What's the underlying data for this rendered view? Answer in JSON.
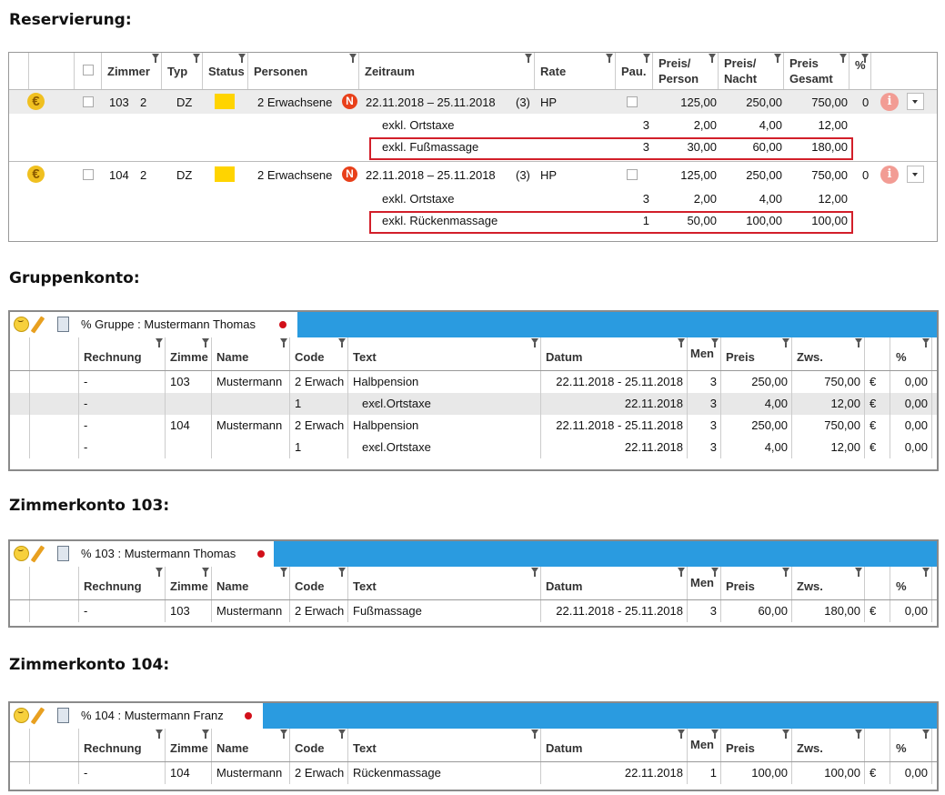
{
  "headings": {
    "reservierung": "Reservierung:",
    "gruppenkonto": "Gruppenkonto:",
    "zimmerkonto103": "Zimmerkonto 103:",
    "zimmerkonto104": "Zimmerkonto 104:"
  },
  "reservation": {
    "columns": {
      "zimmer": "Zimmer",
      "typ": "Typ",
      "status": "Status",
      "personen": "Personen",
      "zeitraum": "Zeitraum",
      "rate": "Rate",
      "pau": "Pau.",
      "preis_person_1": "Preis/",
      "preis_person_2": "Person",
      "preis_nacht_1": "Preis/",
      "preis_nacht_2": "Nacht",
      "preis_gesamt_1": "Preis",
      "preis_gesamt_2": "Gesamt",
      "pct": "%"
    },
    "bookings": [
      {
        "room": "103",
        "count": "2",
        "typ": "DZ",
        "personen": "2 Erwachsene",
        "badge": "N",
        "zeitraum": "22.11.2018 – 25.11.2018",
        "nights": "(3)",
        "rate": "HP",
        "preis_person": "125,00",
        "preis_nacht": "250,00",
        "preis_gesamt": "750,00",
        "pct": "0",
        "extras": [
          {
            "text": "exkl. Ortstaxe",
            "qty": "3",
            "pp": "2,00",
            "pn": "4,00",
            "pg": "12,00",
            "highlight": false
          },
          {
            "text": "exkl. Fußmassage",
            "qty": "3",
            "pp": "30,00",
            "pn": "60,00",
            "pg": "180,00",
            "highlight": true
          }
        ]
      },
      {
        "room": "104",
        "count": "2",
        "typ": "DZ",
        "personen": "2 Erwachsene",
        "badge": "N",
        "zeitraum": "22.11.2018 – 25.11.2018",
        "nights": "(3)",
        "rate": "HP",
        "preis_person": "125,00",
        "preis_nacht": "250,00",
        "preis_gesamt": "750,00",
        "pct": "0",
        "extras": [
          {
            "text": "exkl. Ortstaxe",
            "qty": "3",
            "pp": "2,00",
            "pn": "4,00",
            "pg": "12,00",
            "highlight": false
          },
          {
            "text": "exkl. Rückenmassage",
            "qty": "1",
            "pp": "50,00",
            "pn": "100,00",
            "pg": "100,00",
            "highlight": true
          }
        ]
      }
    ],
    "icons": {
      "euro": "euro-coin-icon",
      "info": "info-icon",
      "dropdown": "chevron-down-icon"
    },
    "colors": {
      "status": "#ffd400",
      "highlight_border": "#d21f2a"
    }
  },
  "account_columns": {
    "rechnung": "Rechnung",
    "zimmer": "Zimme",
    "name": "Name",
    "code": "Code",
    "text": "Text",
    "datum": "Datum",
    "menge": "Men",
    "preis": "Preis",
    "zws": "Zws.",
    "pct": "%"
  },
  "group_account": {
    "tab_label": "% Gruppe :  Mustermann Thomas",
    "rows": [
      {
        "rechnung": "-",
        "zimmer": "103",
        "name": "Mustermann",
        "code": "2 Erwach",
        "excl": "",
        "text": "Halbpension",
        "datum": "22.11.2018 - 25.11.2018",
        "menge": "3",
        "preis": "250,00",
        "zws": "750,00",
        "cur": "€",
        "pct": "0,00"
      },
      {
        "rechnung": "-",
        "zimmer": "",
        "name": "",
        "code": "1",
        "excl": "excl.",
        "text": "Ortstaxe",
        "datum": "22.11.2018",
        "menge": "3",
        "preis": "4,00",
        "zws": "12,00",
        "cur": "€",
        "pct": "0,00"
      },
      {
        "rechnung": "-",
        "zimmer": "104",
        "name": "Mustermann",
        "code": "2 Erwach",
        "excl": "",
        "text": "Halbpension",
        "datum": "22.11.2018 - 25.11.2018",
        "menge": "3",
        "preis": "250,00",
        "zws": "750,00",
        "cur": "€",
        "pct": "0,00"
      },
      {
        "rechnung": "-",
        "zimmer": "",
        "name": "",
        "code": "1",
        "excl": "excl.",
        "text": "Ortstaxe",
        "datum": "22.11.2018",
        "menge": "3",
        "preis": "4,00",
        "zws": "12,00",
        "cur": "€",
        "pct": "0,00"
      }
    ]
  },
  "room103_account": {
    "tab_label": "% 103 :  Mustermann Thomas",
    "rows": [
      {
        "rechnung": "-",
        "zimmer": "103",
        "name": "Mustermann",
        "code": "2 Erwach",
        "text": "Fußmassage",
        "datum": "22.11.2018 - 25.11.2018",
        "menge": "3",
        "preis": "60,00",
        "zws": "180,00",
        "cur": "€",
        "pct": "0,00"
      }
    ]
  },
  "room104_account": {
    "tab_label": "% 104 :  Mustermann Franz",
    "rows": [
      {
        "rechnung": "-",
        "zimmer": "104",
        "name": "Mustermann",
        "code": "2 Erwach",
        "text": "Rückenmassage",
        "datum": "22.11.2018",
        "menge": "1",
        "preis": "100,00",
        "zws": "100,00",
        "cur": "€",
        "pct": "0,00"
      }
    ]
  },
  "tab_icons": [
    "smiley-icon",
    "pencil-icon",
    "calculator-icon",
    "status-dot-icon"
  ],
  "colors": {
    "tab_bar": "#2a9be0",
    "status_dot": "#d2101a"
  }
}
